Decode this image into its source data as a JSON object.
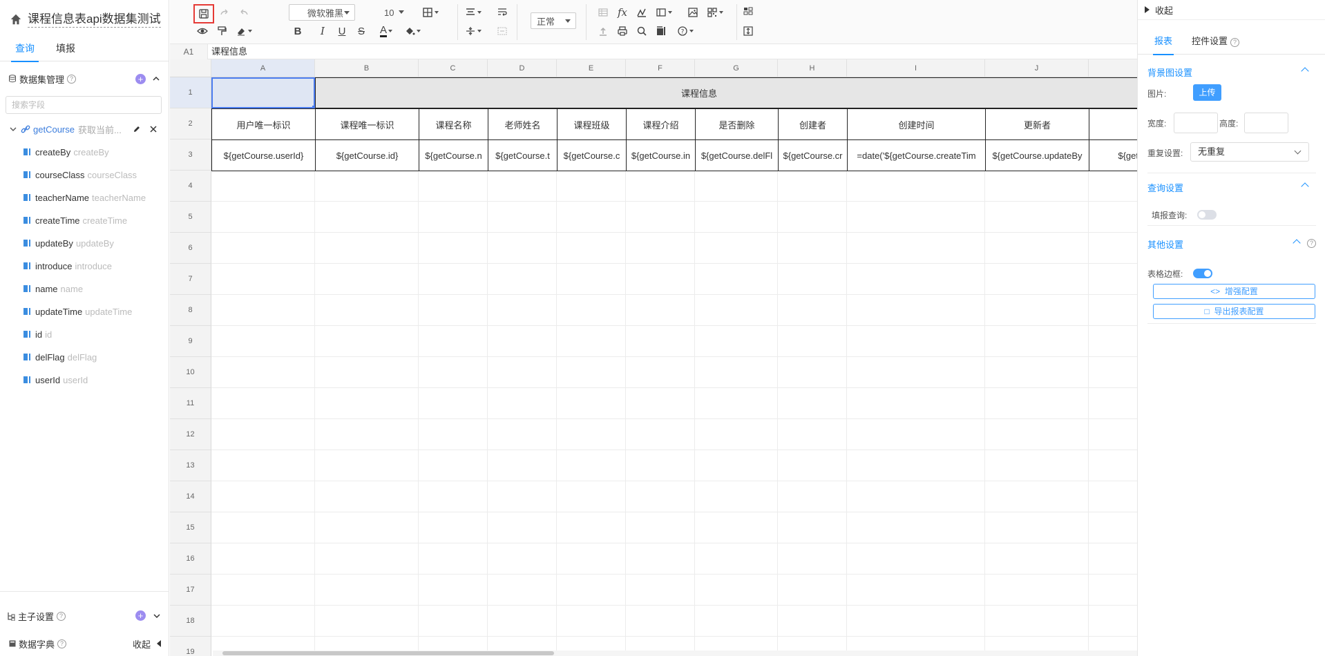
{
  "left": {
    "title": "课程信息表api数据集测试",
    "tabs": [
      "查询",
      "填报"
    ],
    "dataset_header": "数据集管理",
    "search_placeholder": "搜索字段",
    "root": {
      "name": "getCourse",
      "desc": "获取当前..."
    },
    "fields": [
      {
        "en": "createBy",
        "alias": "createBy"
      },
      {
        "en": "courseClass",
        "alias": "courseClass"
      },
      {
        "en": "teacherName",
        "alias": "teacherName"
      },
      {
        "en": "createTime",
        "alias": "createTime"
      },
      {
        "en": "updateBy",
        "alias": "updateBy"
      },
      {
        "en": "introduce",
        "alias": "introduce"
      },
      {
        "en": "name",
        "alias": "name"
      },
      {
        "en": "updateTime",
        "alias": "updateTime"
      },
      {
        "en": "id",
        "alias": "id"
      },
      {
        "en": "delFlag",
        "alias": "delFlag"
      },
      {
        "en": "userId",
        "alias": "userId"
      }
    ],
    "master_sub": "主子设置",
    "dictionary": "数据字典",
    "collapse": "收起"
  },
  "toolbar": {
    "font_family": "微软雅黑",
    "font_size": "10",
    "text_format": "正常"
  },
  "formula_bar": {
    "cell_ref": "A1",
    "value": "课程信息"
  },
  "grid": {
    "columns": [
      "A",
      "B",
      "C",
      "D",
      "E",
      "F",
      "G",
      "H",
      "I",
      "J",
      ""
    ],
    "rows": [
      "1",
      "2",
      "3",
      "4",
      "5",
      "6",
      "7",
      "8",
      "9",
      "10",
      "11",
      "12",
      "13",
      "14",
      "15",
      "16",
      "17",
      "18",
      "19"
    ],
    "title": "课程信息",
    "headers": [
      "用户唯一标识",
      "课程唯一标识",
      "课程名称",
      "老师姓名",
      "课程班级",
      "课程介绍",
      "是否删除",
      "创建者",
      "创建时间",
      "更新者",
      ""
    ],
    "bindings": [
      "${getCourse.userId}",
      "${getCourse.id}",
      "${getCourse.n",
      "${getCourse.t",
      "${getCourse.c",
      "${getCourse.in",
      "${getCourse.delFl",
      "${getCourse.cr",
      "=date('${getCourse.createTim",
      "${getCourse.updateBy",
      "${getCo"
    ]
  },
  "right": {
    "collapse": "收起",
    "tabs": [
      "报表",
      "控件设置"
    ],
    "bg_section": "背景图设置",
    "image_label": "图片:",
    "upload": "上传",
    "width_label": "宽度:",
    "height_label": "高度:",
    "repeat_label": "重复设置:",
    "repeat_value": "无重复",
    "query_section": "查询设置",
    "fill_query_label": "填报查询:",
    "fill_query_on": false,
    "other_section": "其他设置",
    "border_label": "表格边框:",
    "border_on": true,
    "enhance_btn": "增强配置",
    "export_btn": "导出报表配置"
  }
}
